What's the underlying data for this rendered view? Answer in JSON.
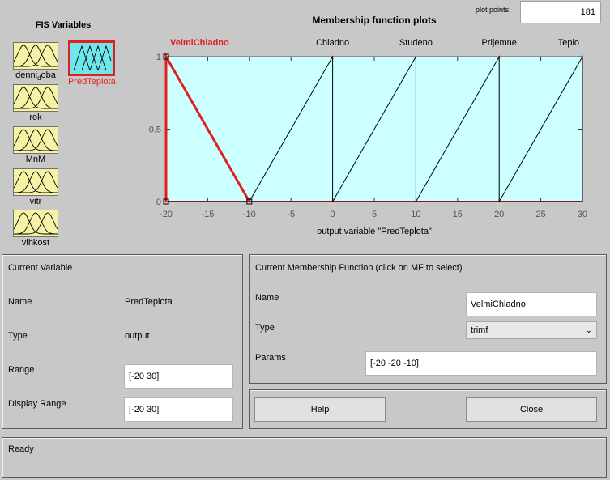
{
  "fis": {
    "title": "FIS Variables",
    "inputs": [
      "denni_doba",
      "rok",
      "MnM",
      "vitr",
      "vlhkost"
    ],
    "denni": {
      "pre": "denni",
      "sub": "d",
      "post": "oba"
    },
    "output": "PredTeplota"
  },
  "plot": {
    "title": "Membership function plots",
    "points_label": "plot points:",
    "points_value": "181",
    "xlabel": "output variable \"PredTeplota\"",
    "yticks": [
      "0",
      "0.5",
      "1"
    ],
    "xticks": [
      "-20",
      "-15",
      "-10",
      "-5",
      "0",
      "5",
      "10",
      "15",
      "20",
      "25",
      "30"
    ]
  },
  "chart_data": {
    "type": "line",
    "title": "Membership function plots",
    "xlabel": "output variable \"PredTeplota\"",
    "ylabel": "",
    "xlim": [
      -20,
      30
    ],
    "ylim": [
      0,
      1
    ],
    "grid": false,
    "selected": "VelmiChladno",
    "series": [
      {
        "name": "VelmiChladno",
        "x": [
          -20,
          -20,
          -10
        ],
        "y": [
          0,
          1,
          0
        ]
      },
      {
        "name": "Chladno",
        "x": [
          -10,
          0,
          0
        ],
        "y": [
          0,
          1,
          0
        ]
      },
      {
        "name": "Studeno",
        "x": [
          0,
          10,
          10
        ],
        "y": [
          0,
          1,
          0
        ]
      },
      {
        "name": "Prijemne",
        "x": [
          10,
          20,
          20
        ],
        "y": [
          0,
          1,
          0
        ]
      },
      {
        "name": "Teplo",
        "x": [
          20,
          30,
          30
        ],
        "y": [
          0,
          1,
          0
        ]
      }
    ],
    "colors": {
      "background": "#ccffff",
      "selected": "#e0201c",
      "line": "#000000",
      "baseline": "#8b1a1a"
    }
  },
  "current_variable": {
    "title": "Current Variable",
    "name_label": "Name",
    "name_value": "PredTeplota",
    "type_label": "Type",
    "type_value": "output",
    "range_label": "Range",
    "range_value": "[-20 30]",
    "display_range_label": "Display Range",
    "display_range_value": "[-20 30]"
  },
  "current_mf": {
    "title": "Current Membership Function (click on MF to select)",
    "name_label": "Name",
    "name_value": "VelmiChladno",
    "type_label": "Type",
    "type_value": "trimf",
    "params_label": "Params",
    "params_value": "[-20 -20 -10]"
  },
  "buttons": {
    "help": "Help",
    "close": "Close"
  },
  "status": {
    "text": "Ready"
  }
}
